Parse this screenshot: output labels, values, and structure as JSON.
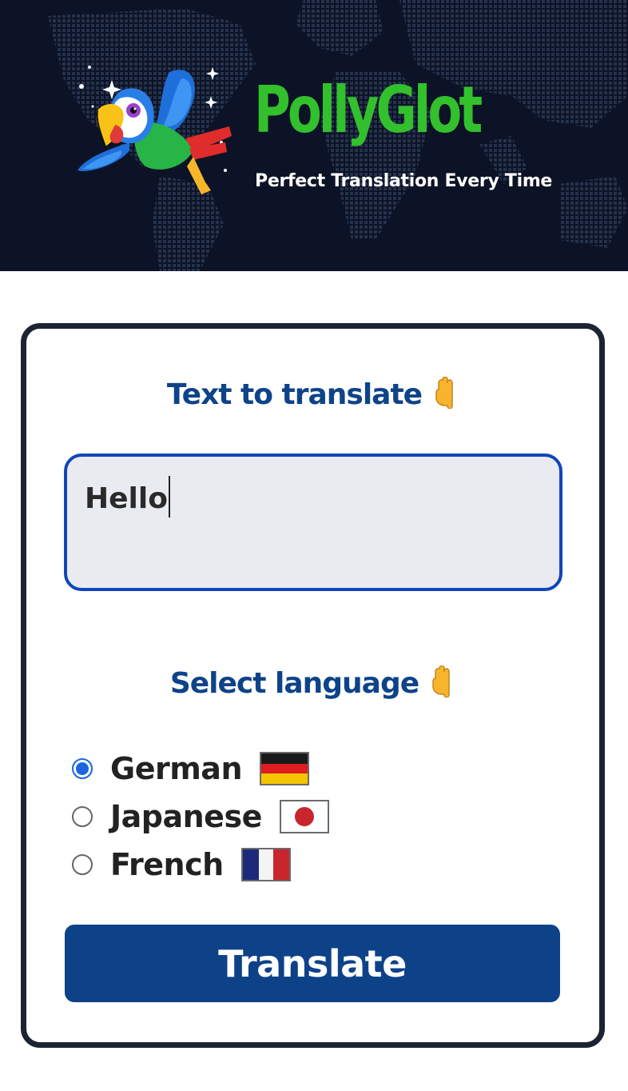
{
  "header": {
    "title": "PollyGlot",
    "tagline": "Perfect Translation Every Time",
    "logo_icon": "parrot-icon",
    "background_icon": "world-map"
  },
  "translate_section": {
    "heading": "Text to translate",
    "pointer_icon": "pointing-down-icon",
    "input_value": "Hello"
  },
  "language_section": {
    "heading": "Select language",
    "pointer_icon": "pointing-down-icon",
    "options": [
      {
        "label": "German",
        "flag_icon": "german-flag-icon",
        "checked": true
      },
      {
        "label": "Japanese",
        "flag_icon": "japanese-flag-icon",
        "checked": false
      },
      {
        "label": "French",
        "flag_icon": "french-flag-icon",
        "checked": false
      }
    ]
  },
  "actions": {
    "translate_label": "Translate"
  },
  "colors": {
    "header_bg": "#0d1326",
    "brand_green": "#32c02c",
    "heading_blue": "#0e4389",
    "button_blue": "#0d4289",
    "input_border": "#1146b8",
    "radio_checked": "#1a66e0"
  }
}
